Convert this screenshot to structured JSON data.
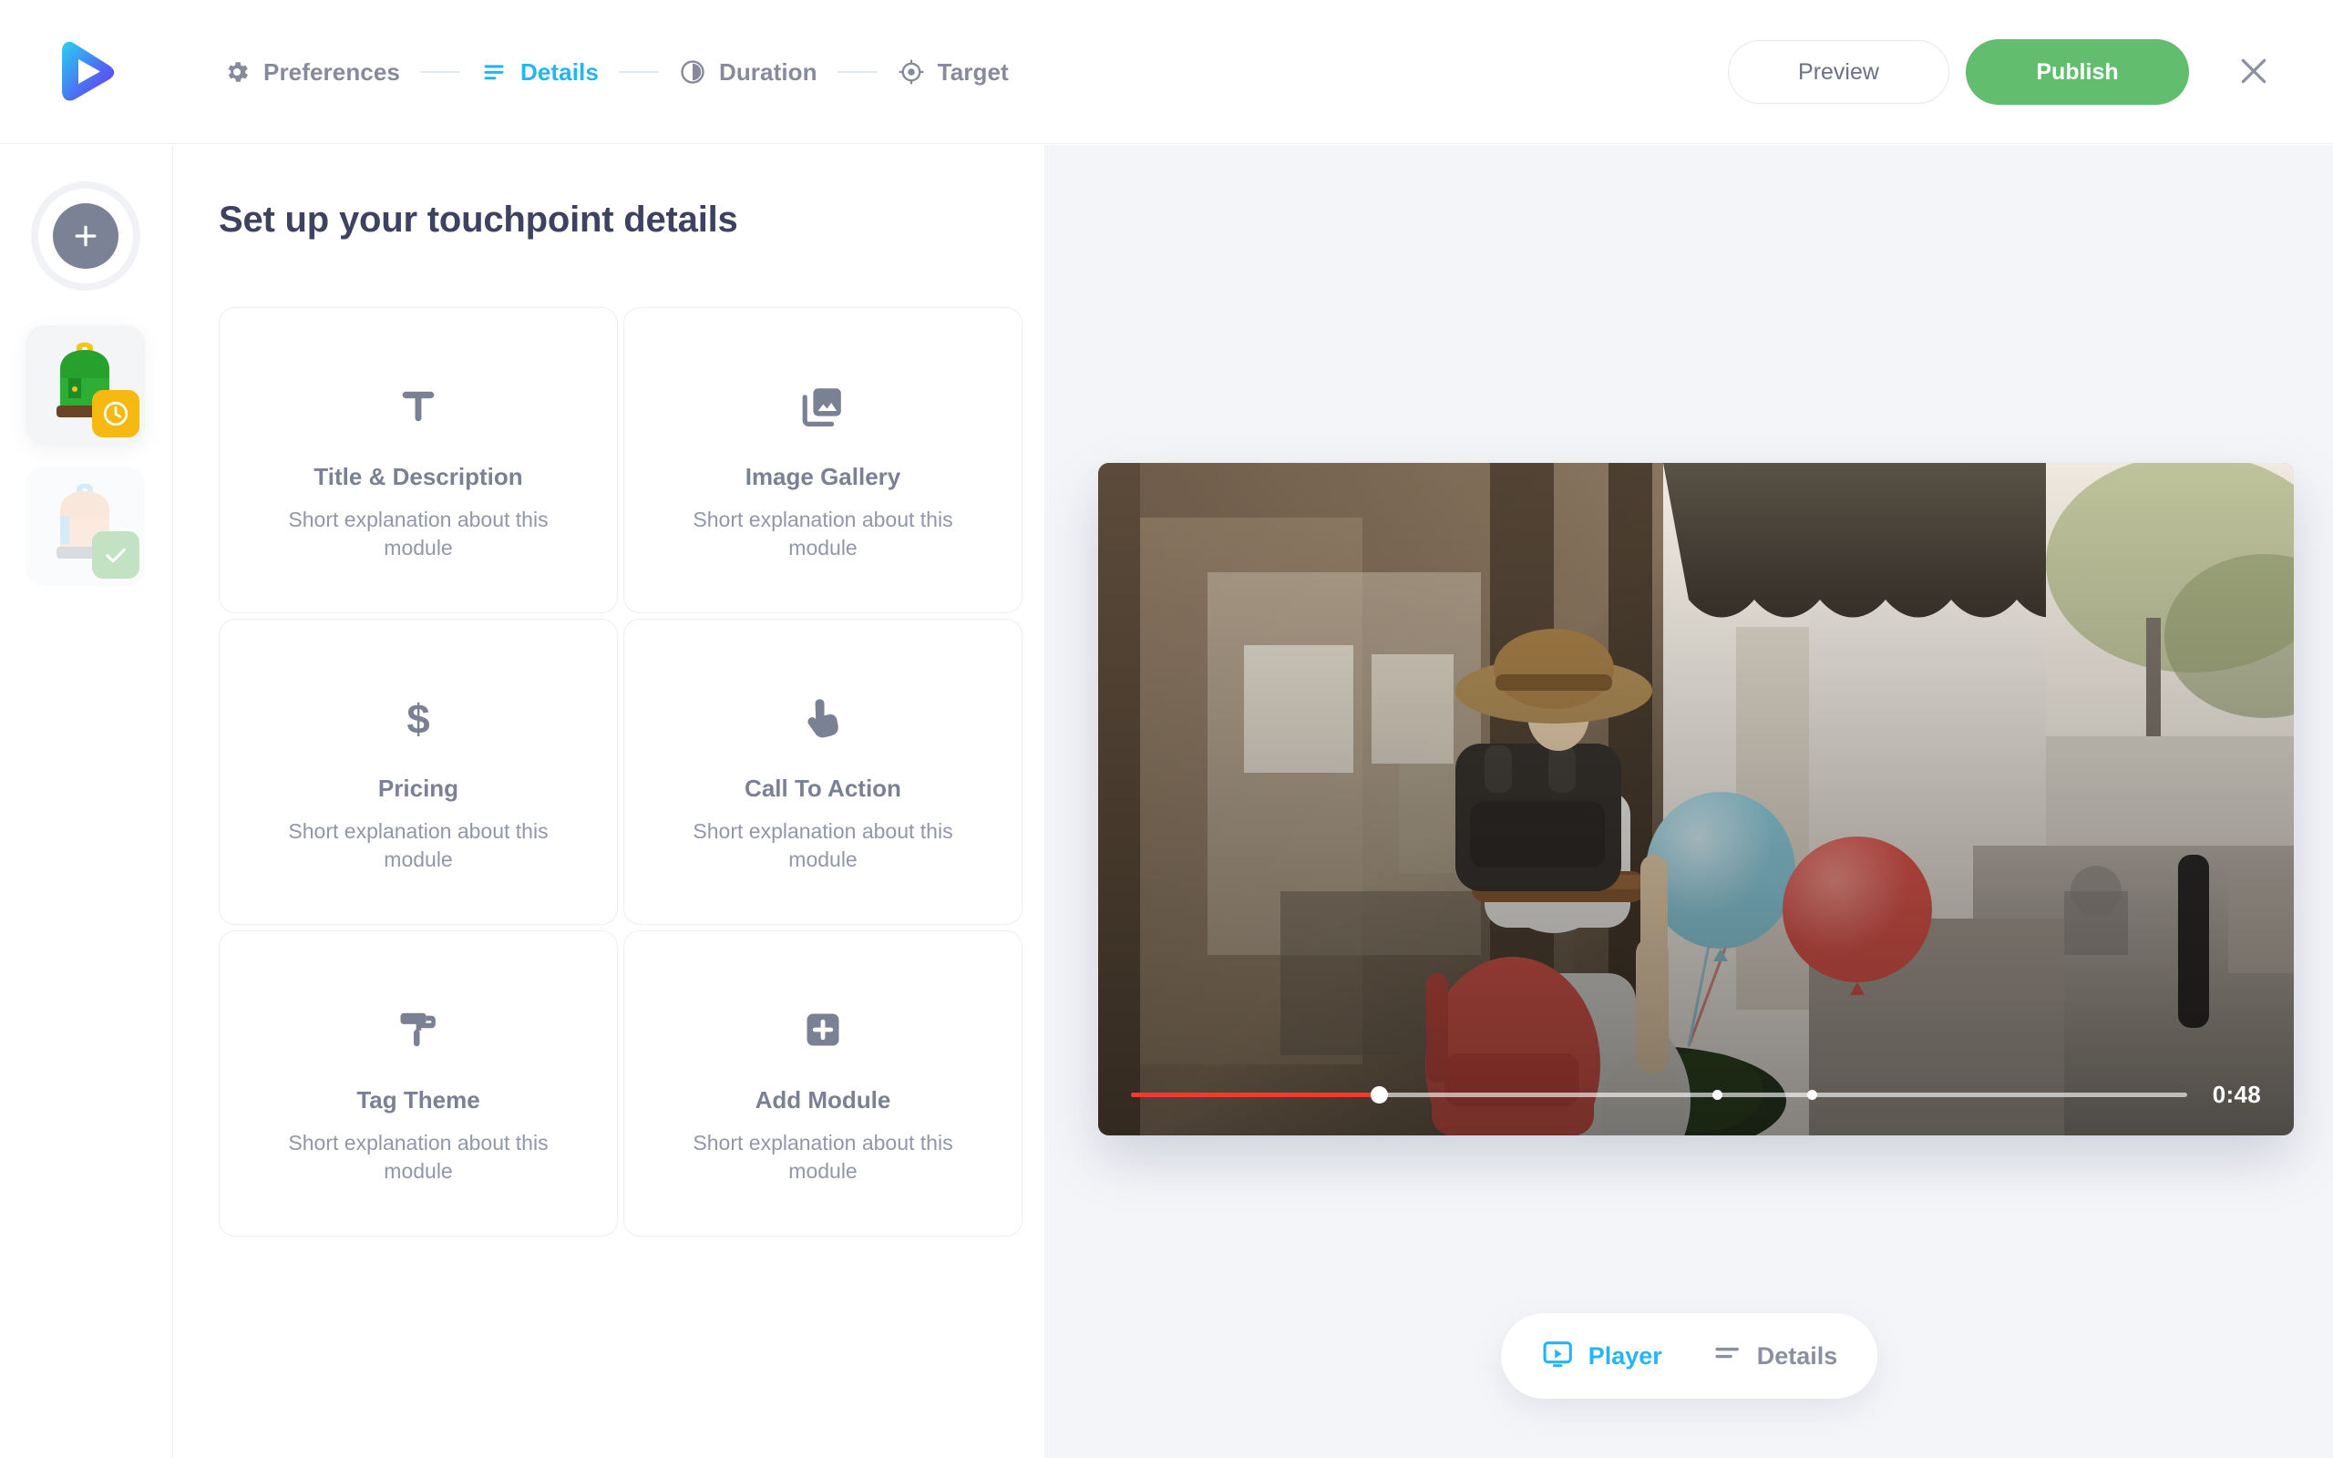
{
  "app": {
    "logo_icon": "play-logo-icon",
    "brand_gradient_from": "#2ad2f0",
    "brand_gradient_to": "#6b2ff0"
  },
  "header": {
    "steps": [
      {
        "label": "Preferences",
        "icon": "gear-icon",
        "active": false
      },
      {
        "label": "Details",
        "icon": "list-lines-icon",
        "active": true
      },
      {
        "label": "Duration",
        "icon": "half-moon-clock-icon",
        "active": false
      },
      {
        "label": "Target",
        "icon": "target-crosshair-icon",
        "active": false
      }
    ],
    "preview_label": "Preview",
    "publish_label": "Publish",
    "close_icon": "close-icon",
    "publish_color": "#62bd6e",
    "active_step_color": "#23b6f5",
    "inactive_step_color": "#868b9c"
  },
  "rail": {
    "add_label": "+",
    "add_icon": "plus-icon",
    "items": [
      {
        "name": "backpack-green-thumbnail",
        "badge": "clock-icon",
        "badge_color": "#f5b912",
        "state": "pending"
      },
      {
        "name": "backpack-peach-thumbnail",
        "badge": "check-icon",
        "badge_color": "#c3e2c3",
        "state": "completed"
      }
    ]
  },
  "main": {
    "title": "Set up your touchpoint details",
    "modules": [
      {
        "title": "Title & Description",
        "desc": "Short explanation about this module",
        "icon": "text-t-icon"
      },
      {
        "title": "Image Gallery",
        "desc": "Short explanation about this module",
        "icon": "image-stack-icon"
      },
      {
        "title": "Pricing",
        "desc": "Short explanation about this module",
        "icon": "dollar-sign-icon"
      },
      {
        "title": "Call To Action",
        "desc": "Short explanation about this module",
        "icon": "tap-hand-icon"
      },
      {
        "title": "Tag Theme",
        "desc": "Short explanation about this module",
        "icon": "paint-roller-icon"
      },
      {
        "title": "Add Module",
        "desc": "Short explanation about this module",
        "icon": "plus-square-icon"
      }
    ]
  },
  "preview": {
    "video": {
      "time_label": "0:48",
      "progress_percent": 23.5,
      "progress_color": "#f4392e",
      "chapter_marks_percent": [
        55.5,
        64.5
      ],
      "scene_description": "Person carrying a child on shoulders walking past a storefront, both wearing backpacks, holding blue and red balloons"
    },
    "tabs": [
      {
        "label": "Player",
        "icon": "player-screen-icon",
        "active": true
      },
      {
        "label": "Details",
        "icon": "list-lines-icon",
        "active": false
      }
    ]
  }
}
